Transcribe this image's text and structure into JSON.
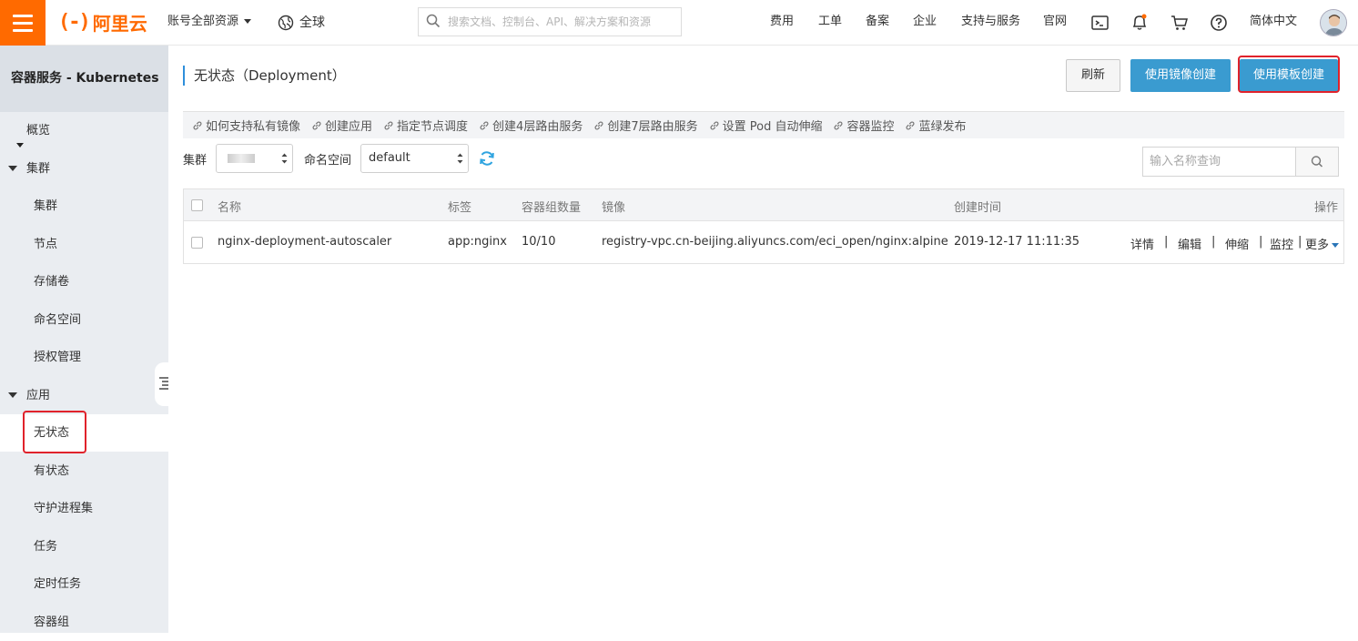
{
  "topbar": {
    "logo_text": "阿里云",
    "account_resources": "账号全部资源",
    "region": "全球",
    "search_placeholder": "搜索文档、控制台、API、解决方案和资源",
    "nav": [
      "费用",
      "工单",
      "备案",
      "企业",
      "支持与服务",
      "官网"
    ],
    "language": "简体中文"
  },
  "sidebar": {
    "product": "容器服务 - Kubernetes",
    "items": [
      {
        "label": "概览",
        "type": "item"
      },
      {
        "label": "集群",
        "type": "group"
      },
      {
        "label": "集群",
        "type": "sub"
      },
      {
        "label": "节点",
        "type": "sub"
      },
      {
        "label": "存储卷",
        "type": "sub"
      },
      {
        "label": "命名空间",
        "type": "sub"
      },
      {
        "label": "授权管理",
        "type": "sub"
      },
      {
        "label": "应用",
        "type": "group"
      },
      {
        "label": "无状态",
        "type": "sub",
        "active": true
      },
      {
        "label": "有状态",
        "type": "sub"
      },
      {
        "label": "守护进程集",
        "type": "sub"
      },
      {
        "label": "任务",
        "type": "sub"
      },
      {
        "label": "定时任务",
        "type": "sub"
      },
      {
        "label": "容器组",
        "type": "sub"
      }
    ]
  },
  "main": {
    "title": "无状态（Deployment）",
    "buttons": {
      "refresh": "刷新",
      "create_from_image": "使用镜像创建",
      "create_from_template": "使用模板创建"
    },
    "links": [
      "如何支持私有镜像",
      "创建应用",
      "指定节点调度",
      "创建4层路由服务",
      "创建7层路由服务",
      "设置 Pod 自动伸缩",
      "容器监控",
      "蓝绿发布"
    ],
    "filters": {
      "cluster_label": "集群",
      "namespace_label": "命名空间",
      "namespace_value": "default",
      "query_placeholder": "输入名称查询"
    },
    "table": {
      "headers": {
        "name": "名称",
        "labels": "标签",
        "pods": "容器组数量",
        "image": "镜像",
        "created": "创建时间",
        "actions": "操作"
      },
      "rows": [
        {
          "name": "nginx-deployment-autoscaler",
          "labels": "app:nginx",
          "pods": "10/10",
          "image": "registry-vpc.cn-beijing.aliyuncs.com/eci_open/nginx:alpine",
          "created": "2019-12-17 11:11:35"
        }
      ],
      "actions": {
        "detail": "详情",
        "edit": "编辑",
        "scale": "伸缩",
        "monitor": "监控",
        "more": "更多"
      }
    }
  },
  "colors": {
    "brand": "#ff6a00",
    "primary": "#3a9bd0",
    "link": "#2a75b8",
    "highlight": "#e0222b"
  }
}
